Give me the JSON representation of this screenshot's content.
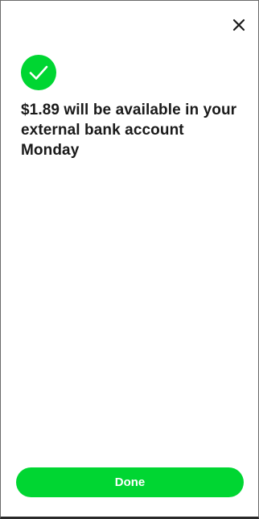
{
  "header": {
    "close_icon": "close-icon"
  },
  "status": {
    "icon": "checkmark-icon",
    "accent_color": "#00d632"
  },
  "main": {
    "message": "$1.89 will be available in your external bank account Monday"
  },
  "footer": {
    "done_label": "Done",
    "button_color": "#00d632"
  }
}
